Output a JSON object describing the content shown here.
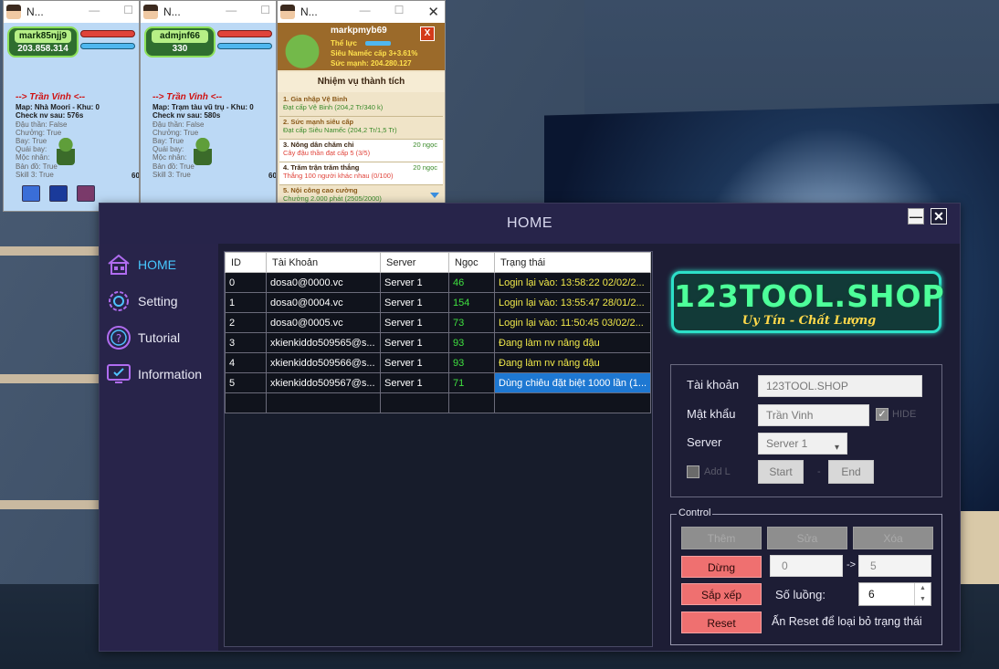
{
  "game_windows": [
    {
      "title": "N...",
      "player_name": "mark85njj9",
      "power": "203.858.314",
      "info_header": "--> Trần Vinh <--",
      "lines": [
        "Map: Nhà Moori - Khu: 0",
        "Check nv sau: 576s",
        "Đậu thần: False",
        "Chưởng: True",
        "Bay: True",
        "Quái bay: ",
        "Mộc nhân:",
        "Bản đồ: True",
        "Skill 3: True"
      ],
      "level": "60-"
    },
    {
      "title": "N...",
      "player_name": "admjnf66",
      "power": "330",
      "info_header": "--> Trần Vinh <--",
      "lines": [
        "Map: Trạm tàu vũ trụ - Khu: 0",
        "Check nv sau: 580s",
        "Đậu thần: False",
        "Chưởng: True",
        "Bay: True",
        "Quái bay:",
        "Mộc nhân:",
        "Bản đồ: True",
        "Skill 3: True"
      ],
      "level": "60-"
    }
  ],
  "mission_window": {
    "title": "N...",
    "player_name": "markpmyb69",
    "stat_label": "Thể lực",
    "form": "Siêu Namếc cấp 3+3.61%",
    "power": "Sức mạnh: 204.280.127",
    "close_label": "X",
    "heading": "Nhiệm vụ thành tích",
    "items": [
      {
        "title": "1. Gia nhập Vệ Binh",
        "desc": "Đạt cấp Vệ Binh (204,2 Tr/340 k)",
        "reward": ""
      },
      {
        "title": "2. Sức mạnh siêu cấp",
        "desc": "Đạt cấp Siêu Namếc (204,2 Tr/1,5 Tr)",
        "reward": ""
      },
      {
        "title": "3. Nông dân chăm chỉ",
        "desc": "Cây đậu thần đạt cấp 5 (3/5)",
        "reward": "20 ngọc"
      },
      {
        "title": "4. Trăm trận trăm thắng",
        "desc": "Thắng 100 người khác nhau (0/100)",
        "reward": "20 ngọc"
      },
      {
        "title": "5. Nội công cao cường",
        "desc": "Chưởng 2.000 phát (2505/2000)",
        "reward": ""
      }
    ]
  },
  "app": {
    "title": "HOME",
    "minimize_label": "—",
    "close_label": "✕",
    "nav": [
      {
        "label": "HOME",
        "icon": "home-icon",
        "active": true
      },
      {
        "label": "Setting",
        "icon": "gear-icon",
        "active": false
      },
      {
        "label": "Tutorial",
        "icon": "question-icon",
        "active": false
      },
      {
        "label": "Information",
        "icon": "monitor-icon",
        "active": false
      }
    ],
    "table": {
      "columns": [
        "ID",
        "Tài Khoản",
        "Server",
        "Ngọc",
        "Trạng thái"
      ],
      "rows": [
        {
          "id": "0",
          "account": "dosa0@0000.vc",
          "server": "Server 1",
          "ngoc": "46",
          "status": "Login lại vào: 13:58:22 02/02/2..."
        },
        {
          "id": "1",
          "account": "dosa0@0004.vc",
          "server": "Server 1",
          "ngoc": "154",
          "status": "Login lại vào: 13:55:47 28/01/2..."
        },
        {
          "id": "2",
          "account": "dosa0@0005.vc",
          "server": "Server 1",
          "ngoc": "73",
          "status": "Login lại vào: 11:50:45 03/02/2..."
        },
        {
          "id": "3",
          "account": "xkienkiddo509565@s...",
          "server": "Server 1",
          "ngoc": "93",
          "status": "Đang làm nv nâng đậu"
        },
        {
          "id": "4",
          "account": "xkienkiddo509566@s...",
          "server": "Server 1",
          "ngoc": "93",
          "status": "Đang làm nv nâng đậu"
        },
        {
          "id": "5",
          "account": "xkienkiddo509567@s...",
          "server": "Server 1",
          "ngoc": "71",
          "status": "Dùng chiêu đặt biệt 1000 lần (1..."
        }
      ]
    },
    "logo": {
      "main": "123TOOL.SHOP",
      "tagline": "Uy Tín - Chất Lượng"
    },
    "login": {
      "account_label": "Tài khoản",
      "account_value": "123TOOL.SHOP",
      "password_label": "Mật khẩu",
      "password_value": "Trần Vinh",
      "hide_label": "HIDE",
      "server_label": "Server",
      "server_value": "Server 1",
      "add_label": "Add L",
      "start_label": "Start",
      "dash": "-",
      "end_label": "End"
    },
    "control": {
      "legend": "Control",
      "add_label": "Thêm",
      "edit_label": "Sửa",
      "delete_label": "Xóa",
      "stop_label": "Dừng",
      "range_from": "0",
      "range_arrow": "->",
      "range_to": "5",
      "sort_label": "Sắp xếp",
      "threads_label": "Số luồng:",
      "threads_value": "6",
      "reset_label": "Reset",
      "reset_hint": "Ấn Reset để loại bỏ trạng thái"
    }
  }
}
